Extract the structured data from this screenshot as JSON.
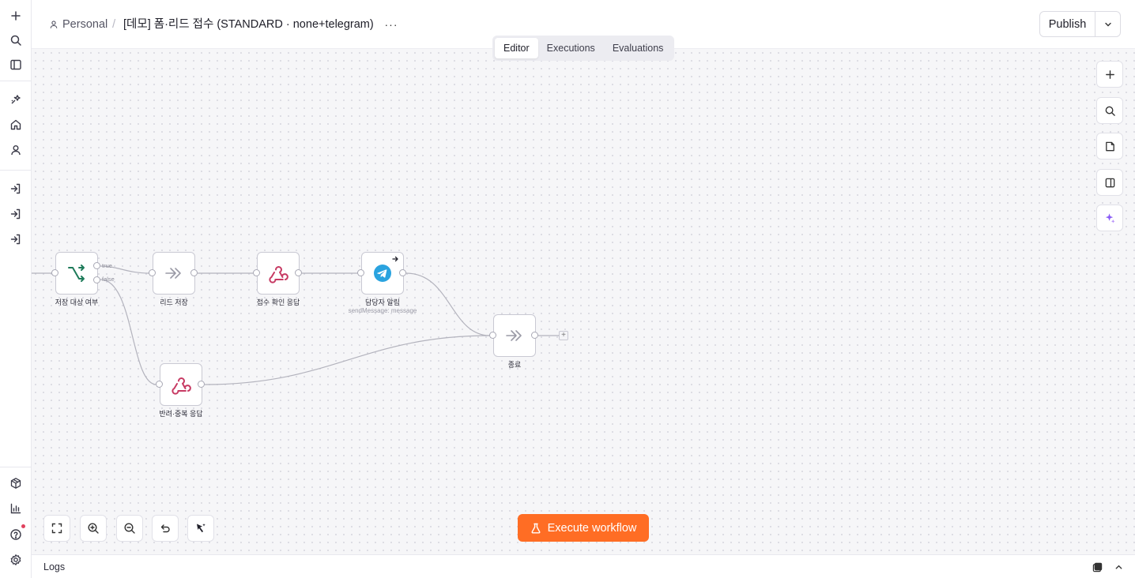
{
  "header": {
    "breadcrumb_project": "Personal",
    "breadcrumb_separator": "/",
    "workflow_title": "[데모] 폼·리드 접수 (STANDARD · none+telegram)",
    "more_label": "···",
    "publish_label": "Publish"
  },
  "tabs": [
    {
      "label": "Editor",
      "active": true
    },
    {
      "label": "Executions",
      "active": false
    },
    {
      "label": "Evaluations",
      "active": false
    }
  ],
  "nodes": [
    {
      "label": "저장 대상 여부",
      "icon": "if-branch-icon"
    },
    {
      "label": "리드 저장",
      "icon": "noop-arrow-icon"
    },
    {
      "label": "접수 확인 응답",
      "icon": "webhook-icon"
    },
    {
      "label": "담당자 알림",
      "subtitle": "sendMessage: message",
      "icon": "telegram-icon"
    },
    {
      "label": "종료",
      "icon": "noop-arrow-icon"
    },
    {
      "label": "반려·중복 응답",
      "icon": "webhook-icon"
    }
  ],
  "edge_labels": {
    "true": "true",
    "false": "false"
  },
  "plus_handle": "+",
  "bottom": {
    "execute_label": "Execute workflow"
  },
  "logs": {
    "label": "Logs"
  },
  "colors": {
    "accent": "#ff6d24",
    "webhook": "#c73a63",
    "telegram": "#2aa3df",
    "if_green": "#1e7b5a",
    "ai": "#8a5cf6"
  }
}
